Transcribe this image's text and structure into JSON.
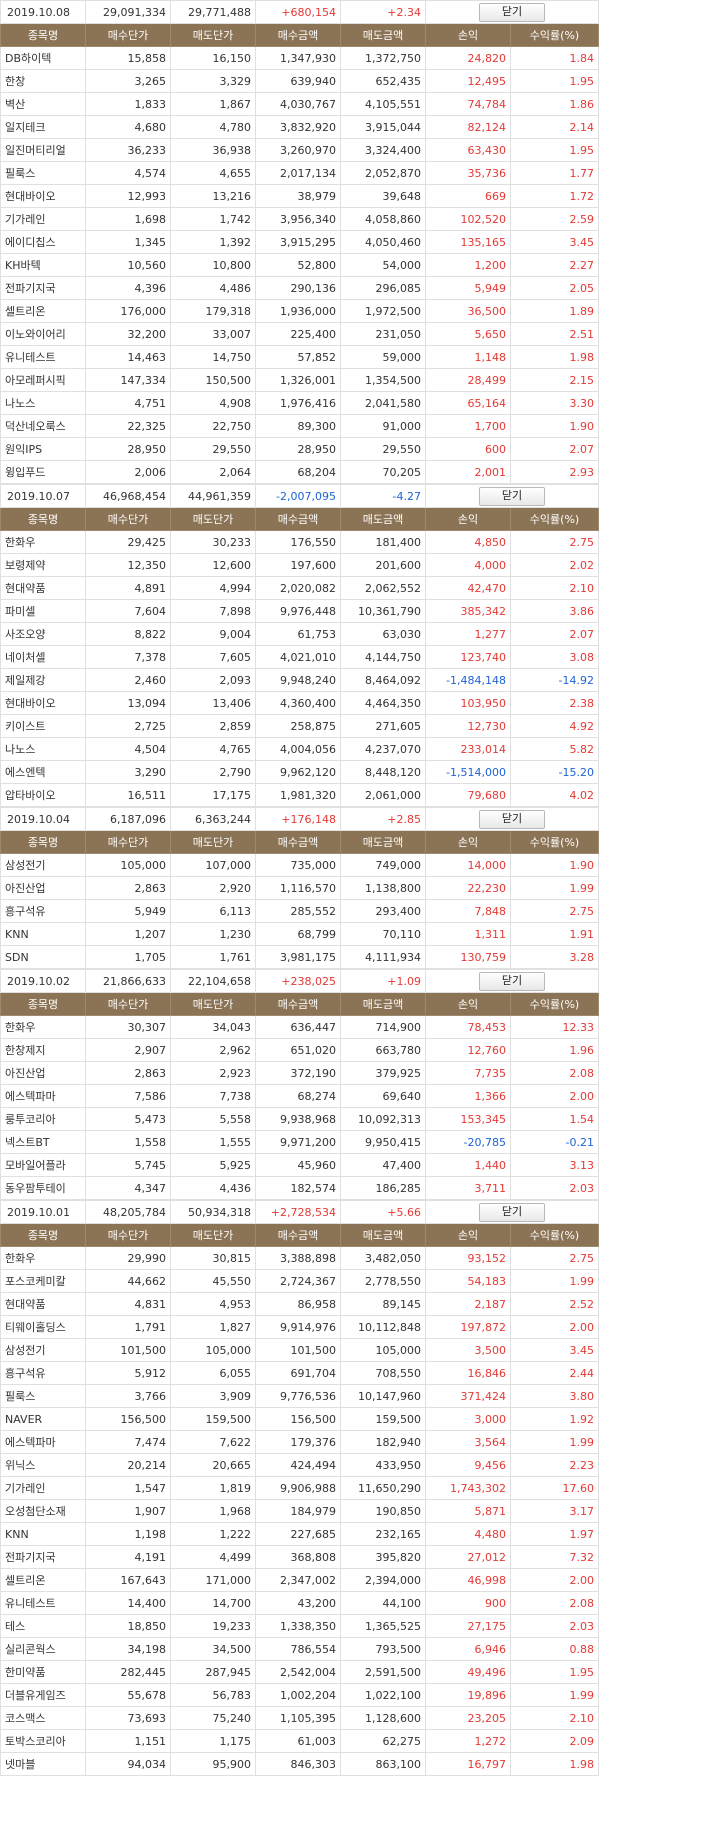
{
  "headers": [
    "종목명",
    "매수단가",
    "매도단가",
    "매수금액",
    "매도금액",
    "손익",
    "수익률(%)"
  ],
  "close_label": "닫기",
  "colors": {
    "header_bg": "#8b7355",
    "positive": "#e53935",
    "negative": "#1e63d6"
  },
  "blocks": [
    {
      "date": "2019.10.08",
      "buy_total": "29,091,334",
      "sell_total": "29,771,488",
      "profit": "+680,154",
      "rate": "+2.34",
      "rows": [
        [
          "DB하이텍",
          "15,858",
          "16,150",
          "1,347,930",
          "1,372,750",
          "24,820",
          "1.84"
        ],
        [
          "한창",
          "3,265",
          "3,329",
          "639,940",
          "652,435",
          "12,495",
          "1.95"
        ],
        [
          "벽산",
          "1,833",
          "1,867",
          "4,030,767",
          "4,105,551",
          "74,784",
          "1.86"
        ],
        [
          "일지테크",
          "4,680",
          "4,780",
          "3,832,920",
          "3,915,044",
          "82,124",
          "2.14"
        ],
        [
          "일진머티리얼",
          "36,233",
          "36,938",
          "3,260,970",
          "3,324,400",
          "63,430",
          "1.95"
        ],
        [
          "필룩스",
          "4,574",
          "4,655",
          "2,017,134",
          "2,052,870",
          "35,736",
          "1.77"
        ],
        [
          "현대바이오",
          "12,993",
          "13,216",
          "38,979",
          "39,648",
          "669",
          "1.72"
        ],
        [
          "기가레인",
          "1,698",
          "1,742",
          "3,956,340",
          "4,058,860",
          "102,520",
          "2.59"
        ],
        [
          "에이디칩스",
          "1,345",
          "1,392",
          "3,915,295",
          "4,050,460",
          "135,165",
          "3.45"
        ],
        [
          "KH바텍",
          "10,560",
          "10,800",
          "52,800",
          "54,000",
          "1,200",
          "2.27"
        ],
        [
          "전파기지국",
          "4,396",
          "4,486",
          "290,136",
          "296,085",
          "5,949",
          "2.05"
        ],
        [
          "셀트리온",
          "176,000",
          "179,318",
          "1,936,000",
          "1,972,500",
          "36,500",
          "1.89"
        ],
        [
          "이노와이어리",
          "32,200",
          "33,007",
          "225,400",
          "231,050",
          "5,650",
          "2.51"
        ],
        [
          "유니테스트",
          "14,463",
          "14,750",
          "57,852",
          "59,000",
          "1,148",
          "1.98"
        ],
        [
          "아모레퍼시픽",
          "147,334",
          "150,500",
          "1,326,001",
          "1,354,500",
          "28,499",
          "2.15"
        ],
        [
          "나노스",
          "4,751",
          "4,908",
          "1,976,416",
          "2,041,580",
          "65,164",
          "3.30"
        ],
        [
          "덕산네오룩스",
          "22,325",
          "22,750",
          "89,300",
          "91,000",
          "1,700",
          "1.90"
        ],
        [
          "원익IPS",
          "28,950",
          "29,550",
          "28,950",
          "29,550",
          "600",
          "2.07"
        ],
        [
          "윙입푸드",
          "2,006",
          "2,064",
          "68,204",
          "70,205",
          "2,001",
          "2.93"
        ]
      ]
    },
    {
      "date": "2019.10.07",
      "buy_total": "46,968,454",
      "sell_total": "44,961,359",
      "profit": "-2,007,095",
      "rate": "-4.27",
      "rows": [
        [
          "한화우",
          "29,425",
          "30,233",
          "176,550",
          "181,400",
          "4,850",
          "2.75"
        ],
        [
          "보령제약",
          "12,350",
          "12,600",
          "197,600",
          "201,600",
          "4,000",
          "2.02"
        ],
        [
          "현대약품",
          "4,891",
          "4,994",
          "2,020,082",
          "2,062,552",
          "42,470",
          "2.10"
        ],
        [
          "파미셀",
          "7,604",
          "7,898",
          "9,976,448",
          "10,361,790",
          "385,342",
          "3.86"
        ],
        [
          "사조오양",
          "8,822",
          "9,004",
          "61,753",
          "63,030",
          "1,277",
          "2.07"
        ],
        [
          "네이처셀",
          "7,378",
          "7,605",
          "4,021,010",
          "4,144,750",
          "123,740",
          "3.08"
        ],
        [
          "제일제강",
          "2,460",
          "2,093",
          "9,948,240",
          "8,464,092",
          "-1,484,148",
          "-14.92"
        ],
        [
          "현대바이오",
          "13,094",
          "13,406",
          "4,360,400",
          "4,464,350",
          "103,950",
          "2.38"
        ],
        [
          "키이스트",
          "2,725",
          "2,859",
          "258,875",
          "271,605",
          "12,730",
          "4.92"
        ],
        [
          "나노스",
          "4,504",
          "4,765",
          "4,004,056",
          "4,237,070",
          "233,014",
          "5.82"
        ],
        [
          "에스엔텍",
          "3,290",
          "2,790",
          "9,962,120",
          "8,448,120",
          "-1,514,000",
          "-15.20"
        ],
        [
          "압타바이오",
          "16,511",
          "17,175",
          "1,981,320",
          "2,061,000",
          "79,680",
          "4.02"
        ]
      ]
    },
    {
      "date": "2019.10.04",
      "buy_total": "6,187,096",
      "sell_total": "6,363,244",
      "profit": "+176,148",
      "rate": "+2.85",
      "rows": [
        [
          "삼성전기",
          "105,000",
          "107,000",
          "735,000",
          "749,000",
          "14,000",
          "1.90"
        ],
        [
          "아진산업",
          "2,863",
          "2,920",
          "1,116,570",
          "1,138,800",
          "22,230",
          "1.99"
        ],
        [
          "흥구석유",
          "5,949",
          "6,113",
          "285,552",
          "293,400",
          "7,848",
          "2.75"
        ],
        [
          "KNN",
          "1,207",
          "1,230",
          "68,799",
          "70,110",
          "1,311",
          "1.91"
        ],
        [
          "SDN",
          "1,705",
          "1,761",
          "3,981,175",
          "4,111,934",
          "130,759",
          "3.28"
        ]
      ]
    },
    {
      "date": "2019.10.02",
      "buy_total": "21,866,633",
      "sell_total": "22,104,658",
      "profit": "+238,025",
      "rate": "+1.09",
      "rows": [
        [
          "한화우",
          "30,307",
          "34,043",
          "636,447",
          "714,900",
          "78,453",
          "12.33"
        ],
        [
          "한창제지",
          "2,907",
          "2,962",
          "651,020",
          "663,780",
          "12,760",
          "1.96"
        ],
        [
          "아진산업",
          "2,863",
          "2,923",
          "372,190",
          "379,925",
          "7,735",
          "2.08"
        ],
        [
          "에스텍파마",
          "7,586",
          "7,738",
          "68,274",
          "69,640",
          "1,366",
          "2.00"
        ],
        [
          "룽투코리아",
          "5,473",
          "5,558",
          "9,938,968",
          "10,092,313",
          "153,345",
          "1.54"
        ],
        [
          "넥스트BT",
          "1,558",
          "1,555",
          "9,971,200",
          "9,950,415",
          "-20,785",
          "-0.21"
        ],
        [
          "모바일어플라",
          "5,745",
          "5,925",
          "45,960",
          "47,400",
          "1,440",
          "3.13"
        ],
        [
          "동우팜투테이",
          "4,347",
          "4,436",
          "182,574",
          "186,285",
          "3,711",
          "2.03"
        ]
      ]
    },
    {
      "date": "2019.10.01",
      "buy_total": "48,205,784",
      "sell_total": "50,934,318",
      "profit": "+2,728,534",
      "rate": "+5.66",
      "rows": [
        [
          "한화우",
          "29,990",
          "30,815",
          "3,388,898",
          "3,482,050",
          "93,152",
          "2.75"
        ],
        [
          "포스코케미칼",
          "44,662",
          "45,550",
          "2,724,367",
          "2,778,550",
          "54,183",
          "1.99"
        ],
        [
          "현대약품",
          "4,831",
          "4,953",
          "86,958",
          "89,145",
          "2,187",
          "2.52"
        ],
        [
          "티웨이홀딩스",
          "1,791",
          "1,827",
          "9,914,976",
          "10,112,848",
          "197,872",
          "2.00"
        ],
        [
          "삼성전기",
          "101,500",
          "105,000",
          "101,500",
          "105,000",
          "3,500",
          "3.45"
        ],
        [
          "흥구석유",
          "5,912",
          "6,055",
          "691,704",
          "708,550",
          "16,846",
          "2.44"
        ],
        [
          "필룩스",
          "3,766",
          "3,909",
          "9,776,536",
          "10,147,960",
          "371,424",
          "3.80"
        ],
        [
          "NAVER",
          "156,500",
          "159,500",
          "156,500",
          "159,500",
          "3,000",
          "1.92"
        ],
        [
          "에스텍파마",
          "7,474",
          "7,622",
          "179,376",
          "182,940",
          "3,564",
          "1.99"
        ],
        [
          "위닉스",
          "20,214",
          "20,665",
          "424,494",
          "433,950",
          "9,456",
          "2.23"
        ],
        [
          "기가레인",
          "1,547",
          "1,819",
          "9,906,988",
          "11,650,290",
          "1,743,302",
          "17.60"
        ],
        [
          "오성첨단소재",
          "1,907",
          "1,968",
          "184,979",
          "190,850",
          "5,871",
          "3.17"
        ],
        [
          "KNN",
          "1,198",
          "1,222",
          "227,685",
          "232,165",
          "4,480",
          "1.97"
        ],
        [
          "전파기지국",
          "4,191",
          "4,499",
          "368,808",
          "395,820",
          "27,012",
          "7.32"
        ],
        [
          "셀트리온",
          "167,643",
          "171,000",
          "2,347,002",
          "2,394,000",
          "46,998",
          "2.00"
        ],
        [
          "유니테스트",
          "14,400",
          "14,700",
          "43,200",
          "44,100",
          "900",
          "2.08"
        ],
        [
          "테스",
          "18,850",
          "19,233",
          "1,338,350",
          "1,365,525",
          "27,175",
          "2.03"
        ],
        [
          "실리콘웍스",
          "34,198",
          "34,500",
          "786,554",
          "793,500",
          "6,946",
          "0.88"
        ],
        [
          "한미약품",
          "282,445",
          "287,945",
          "2,542,004",
          "2,591,500",
          "49,496",
          "1.95"
        ],
        [
          "더블유게임즈",
          "55,678",
          "56,783",
          "1,002,204",
          "1,022,100",
          "19,896",
          "1.99"
        ],
        [
          "코스맥스",
          "73,693",
          "75,240",
          "1,105,395",
          "1,128,600",
          "23,205",
          "2.10"
        ],
        [
          "토박스코리아",
          "1,151",
          "1,175",
          "61,003",
          "62,275",
          "1,272",
          "2.09"
        ],
        [
          "넷마블",
          "94,034",
          "95,900",
          "846,303",
          "863,100",
          "16,797",
          "1.98"
        ]
      ]
    }
  ]
}
